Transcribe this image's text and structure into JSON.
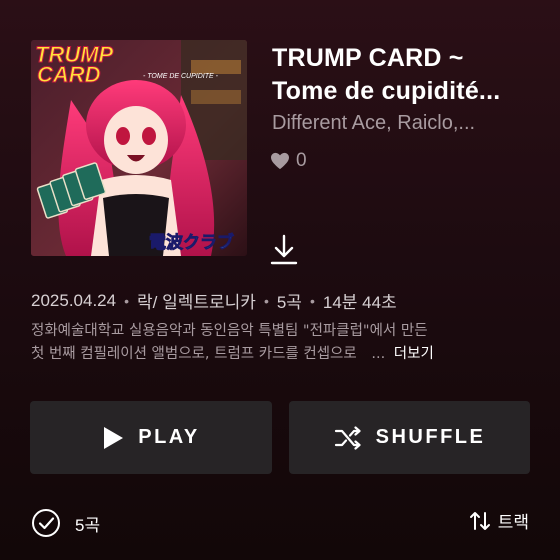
{
  "album": {
    "title_line1": "TRUMP CARD ~",
    "title_line2": "Tome de cupidité...",
    "artists": "Different Ace, Raiclo,...",
    "likes": "0",
    "cover": {
      "logo_line1": "TRUMP",
      "logo_line2": "CARD",
      "logo_sub": "- TOME DE CUPIDITE -",
      "label_text": "電波クラブ"
    }
  },
  "meta": {
    "date": "2025.04.24",
    "genre": "락/ 일렉트로니카",
    "track_count": "5곡",
    "duration": "14분 44초",
    "separator": "•"
  },
  "description": {
    "line1": "정화예술대학교 실용음악과 동인음악 특별팀 \"전파클럽\"에서 만든",
    "line2": "첫 번째 컴필레이션 앨범으로, 트럼프 카드를 컨셉으로",
    "ellipsis": "...",
    "more": "더보기"
  },
  "actions": {
    "play_label": "PLAY",
    "shuffle_label": "SHUFFLE"
  },
  "footer": {
    "select_count": "5곡",
    "sort_label": "트랙"
  },
  "icons": {
    "heart": "heart-icon",
    "download": "download-icon",
    "play": "play-icon",
    "shuffle": "shuffle-icon",
    "check": "check-circle-icon",
    "sort": "sort-icon"
  },
  "colors": {
    "background_top": "#2b0f16",
    "secondary_text": "#a89ba0",
    "button_bg": "#272426"
  }
}
